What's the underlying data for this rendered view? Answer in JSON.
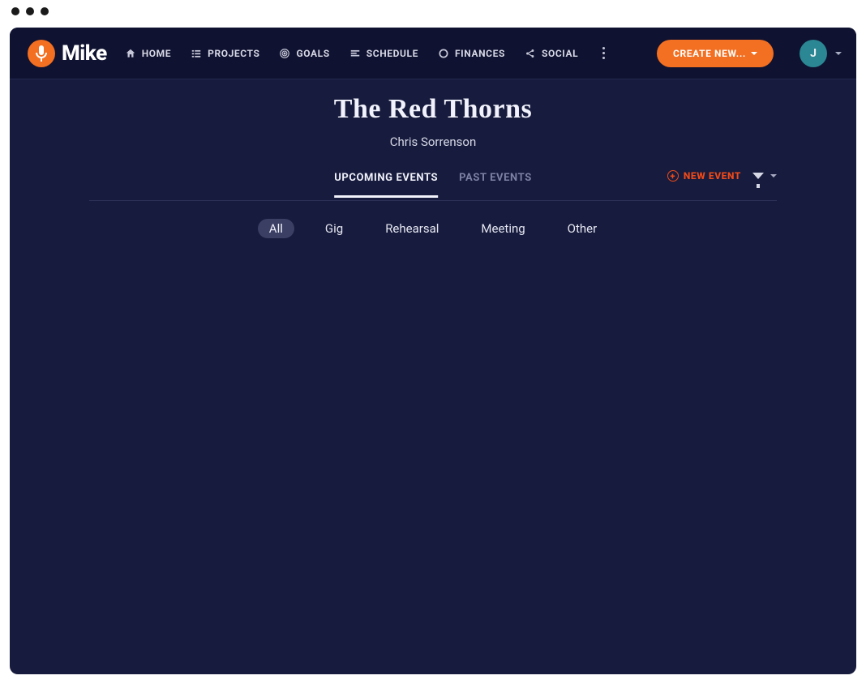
{
  "brand": {
    "name": "Mike"
  },
  "nav": {
    "items": [
      {
        "label": "HOME"
      },
      {
        "label": "PROJECTS"
      },
      {
        "label": "GOALS"
      },
      {
        "label": "SCHEDULE"
      },
      {
        "label": "FINANCES"
      },
      {
        "label": "SOCIAL"
      }
    ]
  },
  "create_button": {
    "label": "CREATE NEW..."
  },
  "user": {
    "initial": "J"
  },
  "page": {
    "title": "The Red Thorns",
    "subtitle": "Chris Sorrenson"
  },
  "tabs": {
    "upcoming": "UPCOMING EVENTS",
    "past": "PAST EVENTS",
    "active": "upcoming"
  },
  "actions": {
    "new_event": "NEW EVENT"
  },
  "filters": {
    "items": [
      "All",
      "Gig",
      "Rehearsal",
      "Meeting",
      "Other"
    ],
    "active_index": 0
  },
  "colors": {
    "accent": "#f36f21",
    "accent_alt": "#f04a18",
    "bg_app": "#171b3d",
    "bg_topbar": "#0f1230",
    "avatar": "#2a8793"
  }
}
